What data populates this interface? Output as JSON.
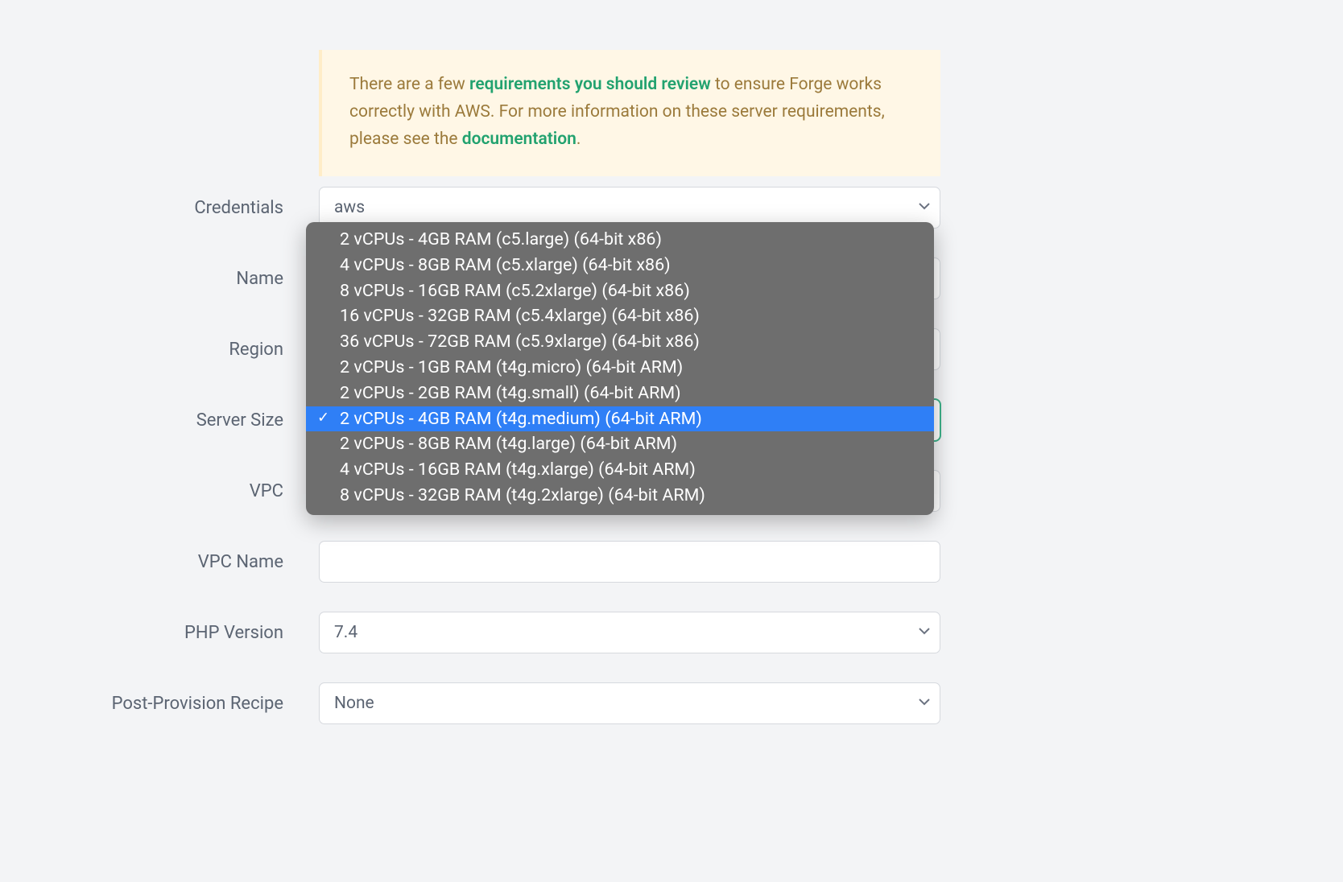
{
  "notice": {
    "prefix": "There are a few ",
    "link1": "requirements you should review",
    "middle": " to ensure Forge works correctly with AWS. For more information on these server requirements, please see the ",
    "link2": "documentation",
    "suffix": "."
  },
  "form": {
    "credentials": {
      "label": "Credentials",
      "value": "aws"
    },
    "name": {
      "label": "Name",
      "value": ""
    },
    "region": {
      "label": "Region",
      "value": ""
    },
    "server_size": {
      "label": "Server Size",
      "value": ""
    },
    "vpc": {
      "label": "VPC",
      "value": ""
    },
    "vpc_name": {
      "label": "VPC Name",
      "value": ""
    },
    "php_version": {
      "label": "PHP Version",
      "value": "7.4"
    },
    "post_provision_recipe": {
      "label": "Post-Provision Recipe",
      "value": "None"
    }
  },
  "server_size_options": [
    {
      "label": "2 vCPUs - 4GB RAM (c5.large) (64-bit x86)",
      "selected": false
    },
    {
      "label": "4 vCPUs - 8GB RAM (c5.xlarge) (64-bit x86)",
      "selected": false
    },
    {
      "label": "8 vCPUs - 16GB RAM (c5.2xlarge) (64-bit x86)",
      "selected": false
    },
    {
      "label": "16 vCPUs - 32GB RAM (c5.4xlarge) (64-bit x86)",
      "selected": false
    },
    {
      "label": "36 vCPUs - 72GB RAM (c5.9xlarge) (64-bit x86)",
      "selected": false
    },
    {
      "label": "2 vCPUs - 1GB RAM (t4g.micro) (64-bit ARM)",
      "selected": false
    },
    {
      "label": "2 vCPUs - 2GB RAM (t4g.small) (64-bit ARM)",
      "selected": false
    },
    {
      "label": "2 vCPUs - 4GB RAM (t4g.medium) (64-bit ARM)",
      "selected": true
    },
    {
      "label": "2 vCPUs - 8GB RAM (t4g.large) (64-bit ARM)",
      "selected": false
    },
    {
      "label": "4 vCPUs - 16GB RAM (t4g.xlarge) (64-bit ARM)",
      "selected": false
    },
    {
      "label": "8 vCPUs - 32GB RAM (t4g.2xlarge) (64-bit ARM)",
      "selected": false
    }
  ]
}
